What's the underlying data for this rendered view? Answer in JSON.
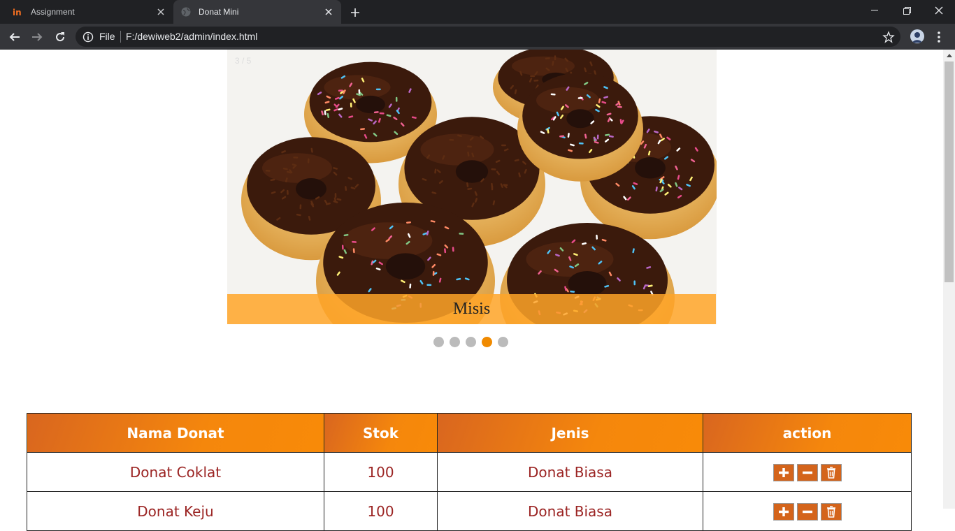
{
  "browser": {
    "tabs": [
      {
        "title": "Assignment",
        "active": false
      },
      {
        "title": "Donat Mini",
        "active": true
      }
    ],
    "address": {
      "scheme_label": "File",
      "url": "F:/dewiweb2/admin/index.html"
    }
  },
  "slideshow": {
    "number_text": "3 / 5",
    "caption": "Misis",
    "dots": 5,
    "active_dot": 4,
    "accent_color": "#f08a00"
  },
  "table": {
    "headers": [
      "Nama Donat",
      "Stok",
      "Jenis",
      "action"
    ],
    "rows": [
      {
        "nama": "Donat Coklat",
        "stok": "100",
        "jenis": "Donat Biasa"
      },
      {
        "nama": "Donat Keju",
        "stok": "100",
        "jenis": "Donat Biasa"
      }
    ],
    "actions": [
      "plus-icon",
      "minus-icon",
      "trash-icon"
    ],
    "header_color": "#f5870c",
    "text_color": "#9b2423"
  }
}
